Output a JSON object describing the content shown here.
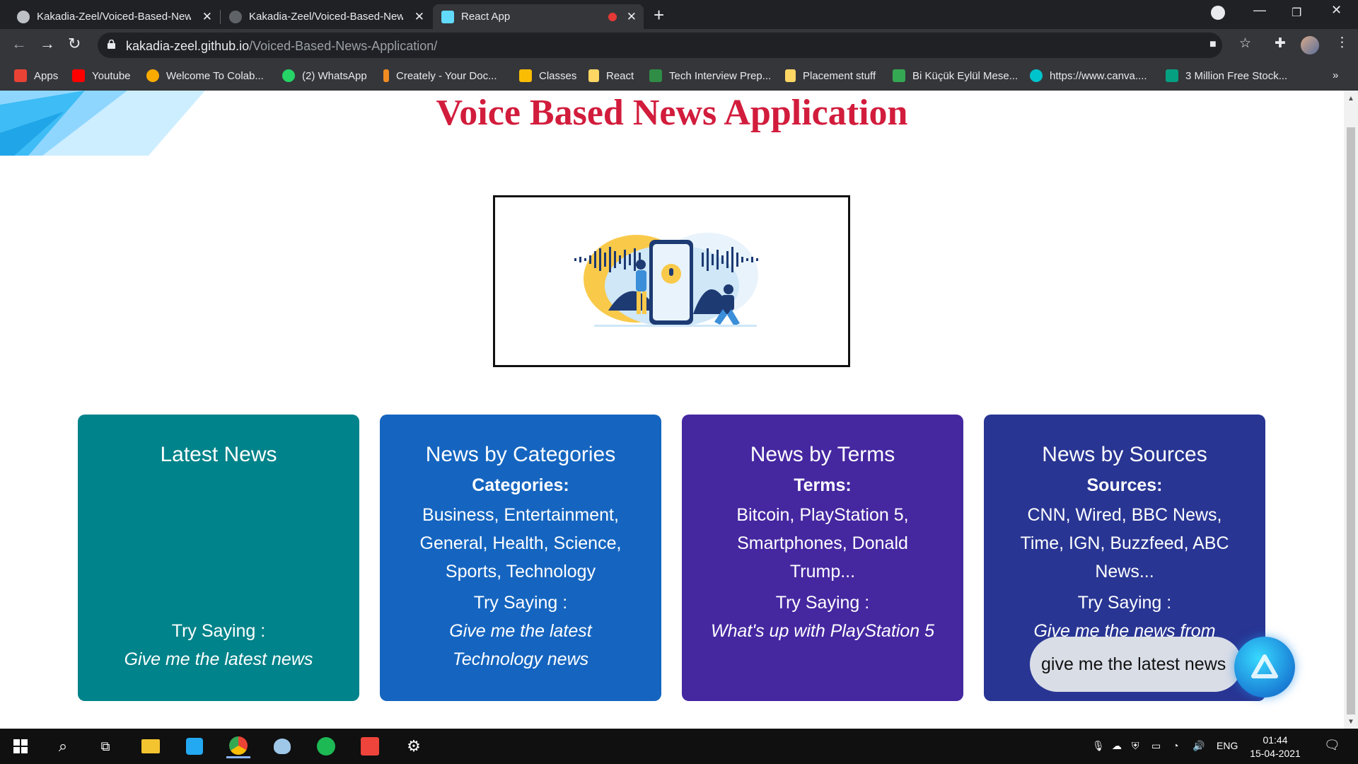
{
  "browser": {
    "tabs": [
      {
        "title": "Kakadia-Zeel/Voiced-Based-New",
        "active": false
      },
      {
        "title": "Kakadia-Zeel/Voiced-Based-New",
        "active": false
      },
      {
        "title": "React App",
        "active": true
      }
    ],
    "url_host": "kakadia-zeel.github.io",
    "url_path": "/Voiced-Based-News-Application/",
    "bookmarks": [
      {
        "label": "Apps",
        "icon": "apps-grid-icon",
        "color": "#ea4335"
      },
      {
        "label": "Youtube",
        "icon": "youtube-icon",
        "color": "#ff0000"
      },
      {
        "label": "Welcome To Colab...",
        "icon": "colab-icon",
        "color": "#f9ab00"
      },
      {
        "label": "(2) WhatsApp",
        "icon": "whatsapp-icon",
        "color": "#25d366"
      },
      {
        "label": "Creately - Your Doc...",
        "icon": "creately-icon",
        "color": "#f28b22"
      },
      {
        "label": "Classes",
        "icon": "classroom-icon",
        "color": "#fbbc04"
      },
      {
        "label": "React",
        "icon": "folder-icon",
        "color": "#fdd663"
      },
      {
        "label": "Tech Interview Prep...",
        "icon": "gfg-icon",
        "color": "#2f8d46"
      },
      {
        "label": "Placement stuff",
        "icon": "folder-icon",
        "color": "#fdd663"
      },
      {
        "label": "Bi Küçük Eylül Mese...",
        "icon": "w-icon",
        "color": "#34a853"
      },
      {
        "label": "https://www.canva....",
        "icon": "canva-icon",
        "color": "#00c4cc"
      },
      {
        "label": "3 Million Free Stock...",
        "icon": "stock-icon",
        "color": "#05a081"
      }
    ]
  },
  "page": {
    "title": "Voice Based News Application",
    "cards": [
      {
        "heading": "Latest News",
        "subheading": "",
        "list": "",
        "try_label": "Try Saying :",
        "example": "Give me the latest news",
        "color": "#00838a"
      },
      {
        "heading": "News by Categories",
        "subheading": "Categories:",
        "list": "Business, Entertainment, General, Health, Science, Sports, Technology",
        "try_label": "Try Saying :",
        "example": "Give me the latest Technology news",
        "color": "#1565c0"
      },
      {
        "heading": "News by Terms",
        "subheading": "Terms:",
        "list": "Bitcoin, PlayStation 5, Smartphones, Donald Trump...",
        "try_label": "Try Saying :",
        "example": "What's up with PlayStation 5",
        "color": "#4527a0"
      },
      {
        "heading": "News by Sources",
        "subheading": "Sources:",
        "list": "CNN, Wired, BBC News, Time, IGN, Buzzfeed, ABC News...",
        "try_label": "Try Saying :",
        "example": "Give me the news from CNN",
        "color": "#283593"
      }
    ],
    "alan_bubble_text": "give me the latest news"
  },
  "taskbar": {
    "tray_language": "ENG",
    "time": "01:44",
    "date": "15-04-2021"
  }
}
